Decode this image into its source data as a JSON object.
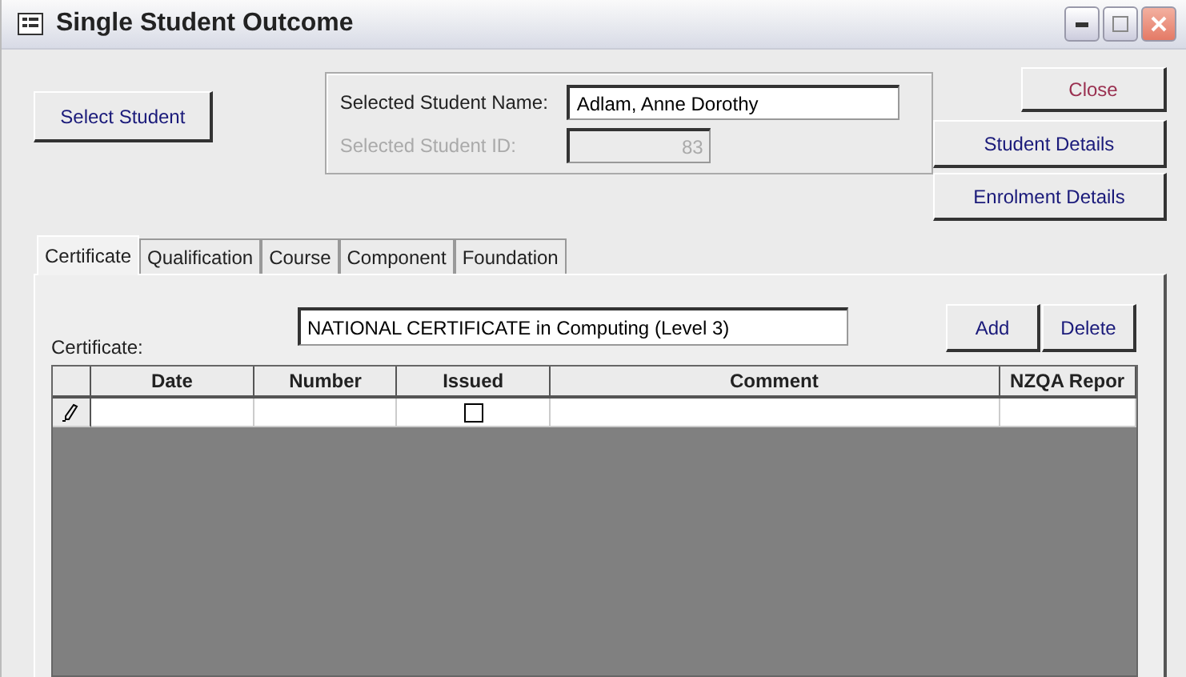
{
  "window": {
    "title": "Single Student Outcome"
  },
  "select_button": "Select Student",
  "student": {
    "name_label": "Selected Student Name:",
    "name_value": "Adlam, Anne Dorothy",
    "id_label": "Selected Student ID:",
    "id_value": "83",
    "id_disabled": true
  },
  "side_buttons": [
    "Close",
    "Student Details",
    "Enrolment Details"
  ],
  "tabs": [
    {
      "label": "Certificate",
      "selected": true
    },
    {
      "label": "Qualification",
      "selected": false
    },
    {
      "label": "Course",
      "selected": false
    },
    {
      "label": "Component",
      "selected": false
    },
    {
      "label": "Foundation",
      "selected": false
    }
  ],
  "certificate": {
    "label": "Certificate:",
    "value": "NATIONAL CERTIFICATE in Computing (Level 3)"
  },
  "action_buttons": [
    "Add",
    "Delete"
  ],
  "table": {
    "columns": [
      "Date",
      "Number",
      "Issued",
      "Comment",
      "NZQA Repor"
    ],
    "rows": [
      {
        "editing": true,
        "cells": [
          "",
          "",
          ""
        ],
        "issued": false
      }
    ]
  }
}
